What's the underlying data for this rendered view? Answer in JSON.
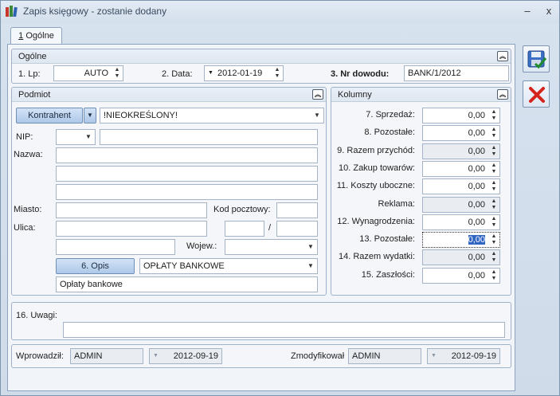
{
  "window": {
    "title": "Zapis księgowy - zostanie dodany",
    "minimize_label": "–",
    "close_label": "x"
  },
  "tabs": [
    {
      "hotkey": "1",
      "label": " Ogólne"
    }
  ],
  "ogolne": {
    "title": "Ogólne",
    "lp_label": "1. Lp:",
    "lp_value": "AUTO",
    "data_label": "2. Data:",
    "data_value": "2012-01-19",
    "nr_label": "3. Nr dowodu:",
    "nr_value": "BANK/1/2012"
  },
  "podmiot": {
    "title": "Podmiot",
    "kontrahent_button": "Kontrahent",
    "kontrahent_value": "!NIEOKREŚLONY!",
    "nip_label": "NIP:",
    "nip_prefix": "",
    "nip_value": "",
    "nazwa_label": "Nazwa:",
    "nazwa_lines": [
      "",
      "",
      ""
    ],
    "miasto_label": "Miasto:",
    "miasto_value": "",
    "kod_label": "Kod pocztowy:",
    "kod_value": "",
    "ulica_label": "Ulica:",
    "ulica_value": "",
    "nr_domu": "",
    "slash": "/",
    "nr_lokalu": "",
    "extra_value": "",
    "wojew_label": "Wojew.:",
    "wojew_value": "",
    "opis_button": "6. Opis",
    "opis_category": "OPŁATY BANKOWE",
    "opis_text": "Opłaty bankowe"
  },
  "kolumny": {
    "title": "Kolumny",
    "rows": [
      {
        "label": "7. Sprzedaż:",
        "value": "0,00"
      },
      {
        "label": "8. Pozostałe:",
        "value": "0,00"
      },
      {
        "label": "9. Razem przychód:",
        "value": "0,00"
      },
      {
        "label": "10. Zakup towarów:",
        "value": "0,00"
      },
      {
        "label": "11. Koszty uboczne:",
        "value": "0,00"
      },
      {
        "label": "Reklama:",
        "value": "0,00"
      },
      {
        "label": "12. Wynagrodzenia:",
        "value": "0,00"
      },
      {
        "label": "13. Pozostałe:",
        "value": "0,00"
      },
      {
        "label": "14. Razem wydatki:",
        "value": "0,00"
      },
      {
        "label": "15. Zaszłości:",
        "value": "0,00"
      }
    ]
  },
  "uwagi": {
    "label": "16. Uwagi:",
    "value": ""
  },
  "footer": {
    "wprowadzil_label": "Wprowadził:",
    "wprowadzil_user": "ADMIN",
    "wprowadzil_date": "2012-09-19",
    "zmodyfikowal_label": "Zmodyfikował",
    "zmodyfikowal_user": "ADMIN",
    "zmodyfikowal_date": "2012-09-19"
  },
  "icons": {
    "save": "save-icon",
    "cancel": "cancel-icon",
    "collapse": "collapse-up-icon"
  }
}
